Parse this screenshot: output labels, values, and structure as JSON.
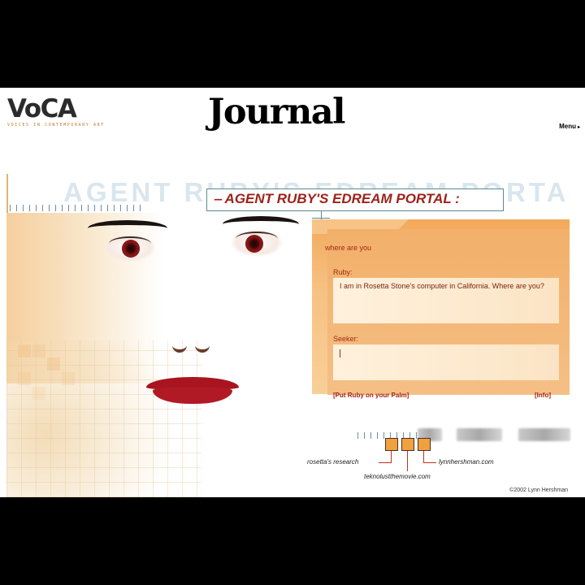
{
  "header": {
    "logo_mark": "VoCA",
    "logo_tagline": "VOICES IN CONTEMPORARY ART",
    "site_title": "Journal",
    "menu_label": "Menu"
  },
  "portal": {
    "ghost_title": "AGENT RUBY'S EDREAM PORTA",
    "title": "AGENT RUBY'S EDREAM PORTAL",
    "chat": {
      "question": "where are you",
      "ruby_label": "Ruby:",
      "ruby_response": "I am in Rosetta Stone's computer in California. Where are you?",
      "seeker_label": "Seeker:",
      "seeker_value": ""
    },
    "links": {
      "palm": "[Put Ruby on your Palm]",
      "info": "[Info]"
    },
    "nav": {
      "rosetta": "rosetta's research",
      "lynn": "lynnhershman.com",
      "teknolust": "teknolustthemovie.com"
    },
    "copyright": "©2002 Lynn Hershman"
  },
  "colors": {
    "accent_red": "#9e2219",
    "panel_orange": "#f3a95a",
    "frame_teal": "#5f8a91"
  }
}
